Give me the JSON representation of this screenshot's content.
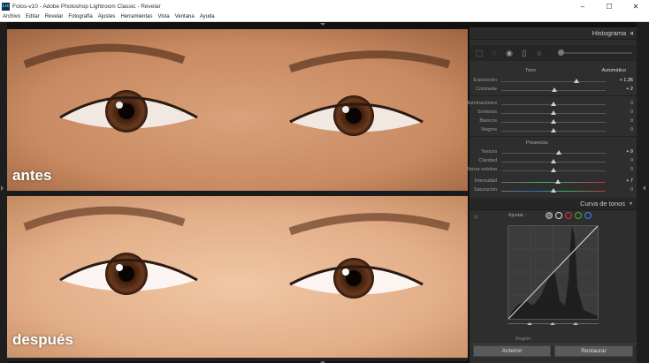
{
  "titlebar": {
    "app_icon": "Lrc",
    "title": "Fotos-v10 - Adobe Photoshop Lightroom Classic - Revelar",
    "min": "–",
    "max": "☐",
    "close": "✕"
  },
  "menu": [
    "Archivo",
    "Editar",
    "Revelar",
    "Fotografía",
    "Ajustes",
    "Herramientas",
    "Vista",
    "Ventana",
    "Ayuda"
  ],
  "viewer": {
    "before_label": "antes",
    "after_label": "después"
  },
  "panel": {
    "histogram_title": "Histograma",
    "tono_label": "Tono",
    "auto_label": "Automático",
    "tone_sliders": [
      {
        "label": "Exposición",
        "value": "+ 1,36",
        "pos": 0.72
      },
      {
        "label": "Contraste",
        "value": "+ 2",
        "pos": 0.51
      }
    ],
    "light_sliders": [
      {
        "label": "Iluminaciones",
        "value": "0",
        "pos": 0.5
      },
      {
        "label": "Sombras",
        "value": "0",
        "pos": 0.5
      },
      {
        "label": "Blancos",
        "value": "0",
        "pos": 0.5
      },
      {
        "label": "Negros",
        "value": "0",
        "pos": 0.5
      }
    ],
    "presencia_label": "Presencia",
    "presence_sliders": [
      {
        "label": "Textura",
        "value": "+ 9",
        "pos": 0.55
      },
      {
        "label": "Claridad",
        "value": "0",
        "pos": 0.5
      },
      {
        "label": "Borrar neblina",
        "value": "0",
        "pos": 0.5
      }
    ],
    "color_sliders": [
      {
        "label": "Intensidad",
        "value": "+ 7",
        "pos": 0.54
      },
      {
        "label": "Saturación",
        "value": "0",
        "pos": 0.5
      }
    ],
    "curve_title": "Curva de tonos",
    "adjust_label": "Ajustar :",
    "region_label": "Región",
    "previous_button": "Anterior",
    "reset_button": "Restaurar"
  },
  "colors": {
    "panel_bg": "#2e2e2e",
    "accent_red": "#d33",
    "accent_green": "#3b3",
    "accent_blue": "#38f"
  }
}
